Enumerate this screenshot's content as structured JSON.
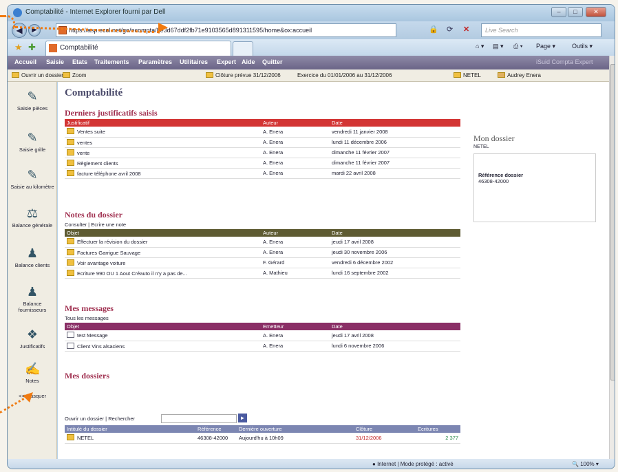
{
  "window": {
    "title": "Comptabilité - Internet Explorer fourni par Dell",
    "controls": [
      "–",
      "□",
      "✕"
    ]
  },
  "addressbar": {
    "url": "https://asp.ecol.net/go/ecompta/8e3d67ddf2fb71e9103565d891311595/home&ox:accueil",
    "search_placeholder": "Live Search"
  },
  "tabsbar": {
    "tab_title": "Comptabilité",
    "page_label": "Page ▾",
    "tools_label": "Outils ▾"
  },
  "appnav": {
    "items": [
      "Accueil",
      "Saisie",
      "Etats",
      "Traitements",
      "Paramètres",
      "Utilitaires",
      "Expert",
      "Aide",
      "Quitter"
    ],
    "right": "iSuid Compta   Expert"
  },
  "subbar": {
    "open": "Ouvrir un dossier",
    "zoom": "Zoom",
    "cloture": "Clôture prévue 31/12/2006",
    "exercice": "Exercice du 01/01/2006 au 31/12/2006",
    "dossier": "NETEL",
    "user": "Audrey Enera"
  },
  "sidebar": {
    "items": [
      {
        "label": "Saisie pièces",
        "icon": "pen-icon"
      },
      {
        "label": "Saisie grille",
        "icon": "grid-pen-icon"
      },
      {
        "label": "Saisie au kilomètre",
        "icon": "pen-lines-icon"
      },
      {
        "label": "Balance générale",
        "icon": "balance-icon"
      },
      {
        "label": "Balance clients",
        "icon": "clients-icon"
      },
      {
        "label": "Balance fournisseurs",
        "icon": "suppliers-icon"
      },
      {
        "label": "Justificatifs",
        "icon": "documents-icon"
      },
      {
        "label": "Notes",
        "icon": "notes-icon"
      },
      {
        "label": "<< masquer",
        "icon": ""
      }
    ]
  },
  "main": {
    "title": "Comptabilité",
    "justificatifs": {
      "heading": "Derniers justificatifs saisis",
      "columns": [
        "Justificatif",
        "Auteur",
        "Date"
      ],
      "rows": [
        [
          "Ventes suite",
          "A. Enera",
          "vendredi 11 janvier 2008"
        ],
        [
          "ventes",
          "A. Enera",
          "lundi 11 décembre 2006"
        ],
        [
          "vente",
          "A. Enera",
          "dimanche 11 février 2007"
        ],
        [
          "Règlement clients",
          "A. Enera",
          "dimanche 11 février 2007"
        ],
        [
          "facture téléphone avril 2008",
          "A. Enera",
          "mardi 22 avril 2008"
        ]
      ]
    },
    "notes": {
      "heading": "Notes du dossier",
      "links": "Consulter | Ecrire une note",
      "columns": [
        "Objet",
        "Auteur",
        "Date"
      ],
      "rows": [
        [
          "Effectuer la révision du dossier",
          "A. Enera",
          "jeudi 17 avril 2008"
        ],
        [
          "Factures Garrigue Sauvage",
          "A. Enera",
          "jeudi 30 novembre 2006"
        ],
        [
          "Voir avantage voiture",
          "F. Gérard",
          "vendredi 6 décembre 2002"
        ],
        [
          "Ecriture 990 OU 1 Aout Créauto il n'y a pas de...",
          "A. Mathieu",
          "lundi 16 septembre 2002"
        ]
      ]
    },
    "messages": {
      "heading": "Mes messages",
      "links": "Tous les messages",
      "columns": [
        "Objet",
        "Emetteur",
        "Date"
      ],
      "rows": [
        [
          "test Message",
          "A. Enera",
          "jeudi 17 avril 2008"
        ],
        [
          "Client Vins alsaciens",
          "A. Enera",
          "lundi 6 novembre 2006"
        ]
      ]
    },
    "dossiers": {
      "heading": "Mes dossiers",
      "links": "Ouvrir un dossier | Rechercher",
      "go": "►",
      "columns": [
        "Intitulé du dossier",
        "Référence",
        "Dernière ouverture",
        "Clôture",
        "Ecritures"
      ],
      "rows": [
        [
          "NETEL",
          "46308-42000",
          "Aujourd'hu à 10h09",
          "31/12/2006",
          "2 377"
        ]
      ]
    },
    "side": {
      "title": "Mon dossier",
      "name": "NETEL",
      "ref_label": "Référence dossier",
      "ref_value": "46308-42000"
    }
  },
  "status": {
    "zone": "Internet | Mode protégé : activé",
    "zoom": "100%"
  },
  "colors": {
    "annotation": "#f07a10",
    "nav": "#6a6487"
  }
}
